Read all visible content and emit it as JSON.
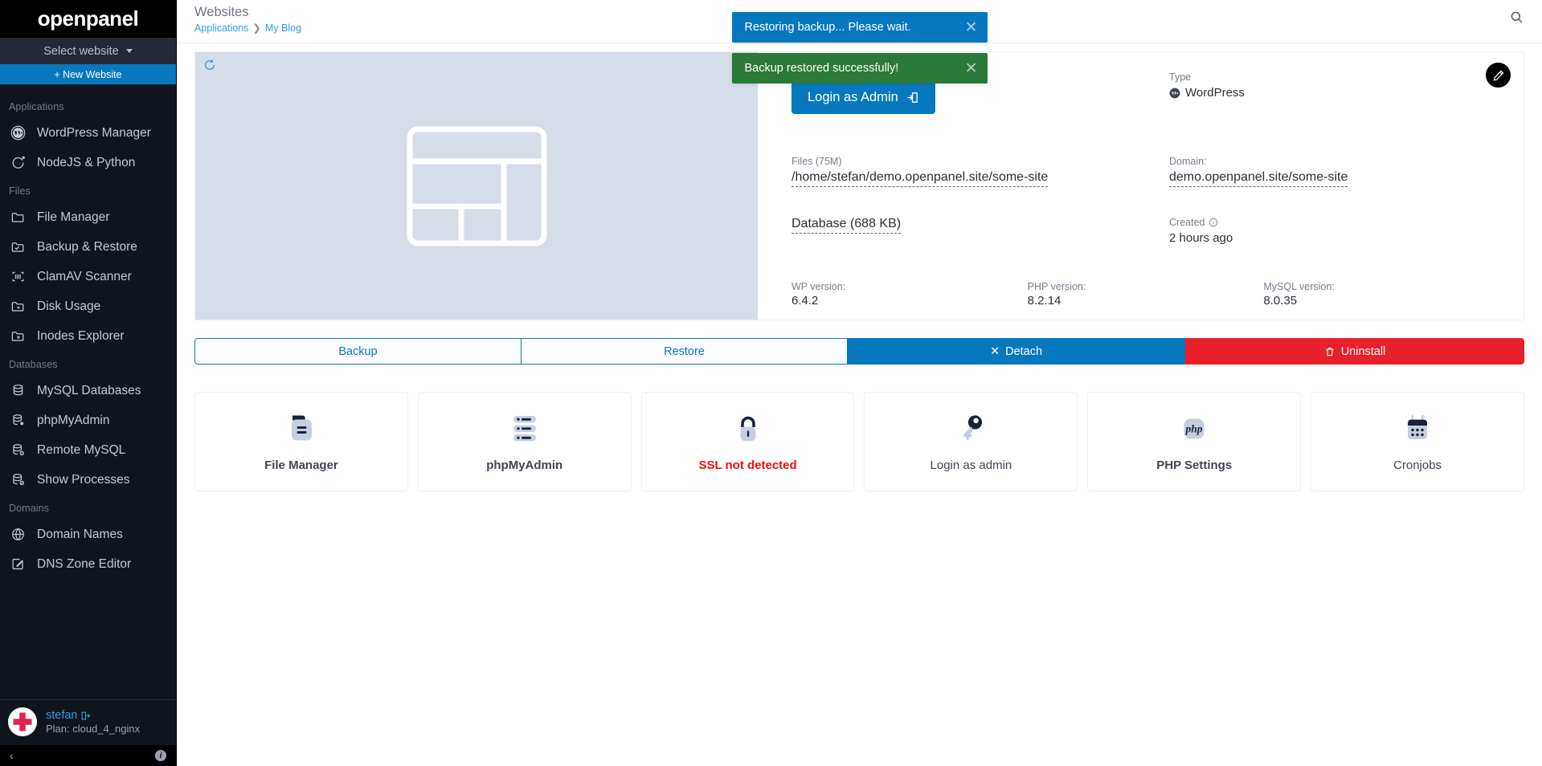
{
  "brand": {
    "name": "openpanel"
  },
  "sidebar": {
    "site_selector": {
      "label": "Select website",
      "icon": "chevron-down-icon"
    },
    "new_website_button": {
      "label": "+ New Website"
    },
    "groups": [
      {
        "title": "Applications",
        "items": [
          {
            "label": "WordPress Manager",
            "icon": "wordpress-icon"
          },
          {
            "label": "NodeJS & Python",
            "icon": "nodejs-icon"
          }
        ]
      },
      {
        "title": "Files",
        "items": [
          {
            "label": "File Manager",
            "icon": "folder-icon"
          },
          {
            "label": "Backup & Restore",
            "icon": "folder-check-icon"
          },
          {
            "label": "ClamAV Scanner",
            "icon": "scan-icon"
          },
          {
            "label": "Disk Usage",
            "icon": "folder-plus-icon"
          },
          {
            "label": "Inodes Explorer",
            "icon": "folder-x-icon"
          }
        ]
      },
      {
        "title": "Databases",
        "items": [
          {
            "label": "MySQL Databases",
            "icon": "database-icon"
          },
          {
            "label": "phpMyAdmin",
            "icon": "database-gear-icon"
          },
          {
            "label": "Remote MySQL",
            "icon": "database-info-icon"
          },
          {
            "label": "Show Processes",
            "icon": "database-block-icon"
          }
        ]
      },
      {
        "title": "Domains",
        "items": [
          {
            "label": "Domain Names",
            "icon": "globe-icon"
          },
          {
            "label": "DNS Zone Editor",
            "icon": "edit-square-icon"
          }
        ]
      }
    ],
    "user": {
      "name": "stefan",
      "logout_icon": "logout-icon",
      "plan": "Plan: cloud_4_nginx",
      "avatar_icon": "cross-avatar-icon"
    },
    "footer": {
      "collapse_icon": "chevron-left-icon",
      "info_icon": "info-icon"
    }
  },
  "header": {
    "title": "Websites",
    "breadcrumb": {
      "root": "Applications",
      "separator": "❯",
      "current": "My Blog"
    },
    "search_icon": "search-icon"
  },
  "toasts": [
    {
      "type": "info",
      "message": "Restoring backup... Please wait.",
      "close_icon": "close-icon"
    },
    {
      "type": "success",
      "message": "Backup restored successfully!",
      "close_icon": "close-icon"
    }
  ],
  "site_panel": {
    "thumbnail": {
      "refresh_icon": "refresh-icon",
      "placeholder_icon": "layout-wireframe-icon"
    },
    "login_button": {
      "label": "Login as Admin",
      "icon": "login-icon"
    },
    "type": {
      "label": "Type",
      "value": "WordPress",
      "icon": "wordpress-icon"
    },
    "files": {
      "label": "Files (75M)",
      "value": "/home/stefan/demo.openpanel.site/some-site"
    },
    "domain": {
      "label": "Domain:",
      "value": "demo.openpanel.site/some-site"
    },
    "database": {
      "label": "Database (688 KB)"
    },
    "created": {
      "label": "Created",
      "info_icon": "info-circle-icon",
      "value": "2 hours ago"
    },
    "versions": [
      {
        "label": "WP version:",
        "value": "6.4.2"
      },
      {
        "label": "PHP version:",
        "value": "8.2.14"
      },
      {
        "label": "MySQL version:",
        "value": "8.0.35"
      }
    ],
    "edit_fab": {
      "icon": "pencil-icon"
    }
  },
  "actions": [
    {
      "label": "Backup",
      "style": "outline",
      "icon": null
    },
    {
      "label": "Restore",
      "style": "outline",
      "icon": null
    },
    {
      "label": "Detach",
      "style": "blue",
      "icon": "x-icon"
    },
    {
      "label": "Uninstall",
      "style": "red",
      "icon": "trash-icon"
    }
  ],
  "tiles": [
    {
      "label": "File Manager",
      "icon": "file-manager-icon",
      "state": "normal"
    },
    {
      "label": "phpMyAdmin",
      "icon": "server-list-icon",
      "state": "normal"
    },
    {
      "label": "SSL not detected",
      "icon": "lock-icon",
      "state": "danger"
    },
    {
      "label": "Login as admin",
      "icon": "key-icon",
      "state": "plain"
    },
    {
      "label": "PHP Settings",
      "icon": "php-icon",
      "state": "normal"
    },
    {
      "label": "Cronjobs",
      "icon": "calendar-icon",
      "state": "plain"
    }
  ],
  "colors": {
    "brand_blue": "#0778bd",
    "success_green": "#2b7a39",
    "danger_red": "#e8202a",
    "danger_text": "#f20c0c",
    "sidebar_bg": "#10141c",
    "icon_light": "#c5cfe0",
    "icon_dark": "#1a2238",
    "avatar_red": "#e0234e"
  }
}
